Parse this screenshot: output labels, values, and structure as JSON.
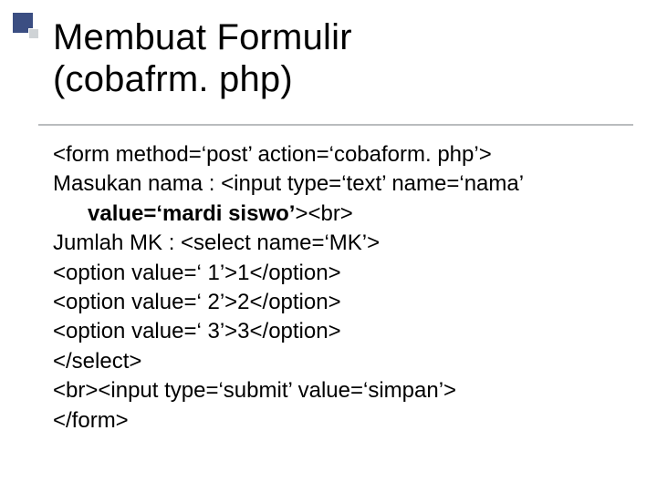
{
  "title": {
    "line1": "Membuat Formulir",
    "line2": "(cobafrm. php)"
  },
  "code": {
    "l1": "<form method=‘post’ action=‘cobaform. php’>",
    "l2": "Masukan nama : <input type=‘text’ name=‘nama’",
    "l3a": "value=‘mardi siswo’",
    "l3b": "><br>",
    "l4": "Jumlah MK : <select name=‘MK’>",
    "l5": "<option value=‘ 1’>1</option>",
    "l6": "<option value=‘ 2’>2</option>",
    "l7": "<option value=‘ 3’>3</option>",
    "l8": "</select>",
    "l9": "<br><input type=‘submit’ value=‘simpan’>",
    "l10": "</form>"
  }
}
